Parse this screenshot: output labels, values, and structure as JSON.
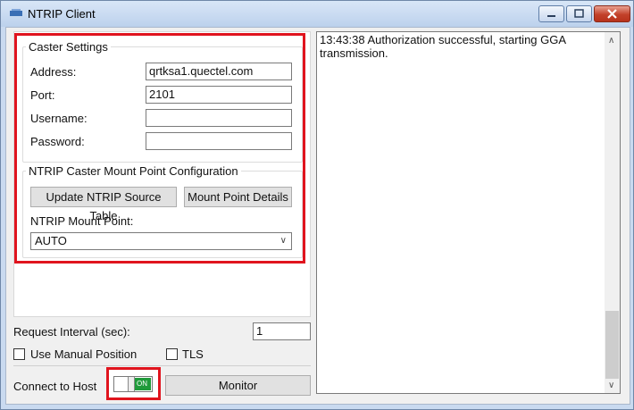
{
  "window": {
    "title": "NTRIP Client",
    "icons": [
      "app-icon",
      "minimize-icon",
      "maximize-icon",
      "close-icon"
    ]
  },
  "caster": {
    "group_label": "Caster Settings",
    "address_label": "Address:",
    "address_value": "qrtksa1.quectel.com",
    "port_label": "Port:",
    "port_value": "2101",
    "username_label": "Username:",
    "username_value": "",
    "password_label": "Password:",
    "password_value": ""
  },
  "mount": {
    "group_label": "NTRIP Caster Mount Point Configuration",
    "update_button": "Update NTRIP Source Table",
    "details_button": "Mount Point Details",
    "mount_point_label": "NTRIP Mount Point:",
    "mount_point_value": "AUTO"
  },
  "options": {
    "interval_label": "Request Interval (sec):",
    "interval_value": "1",
    "manual_position_label": "Use Manual Position",
    "manual_position_checked": false,
    "tls_label": "TLS",
    "tls_checked": false
  },
  "connection": {
    "connect_label": "Connect to Host",
    "toggle_text": "ON",
    "toggle_on": true,
    "monitor_button": "Monitor"
  },
  "log": {
    "entries": [
      "13:43:38   Authorization successful, starting GGA transmission."
    ]
  },
  "colors": {
    "highlight": "#e0141e",
    "toggle_on": "#1f9a3a"
  }
}
